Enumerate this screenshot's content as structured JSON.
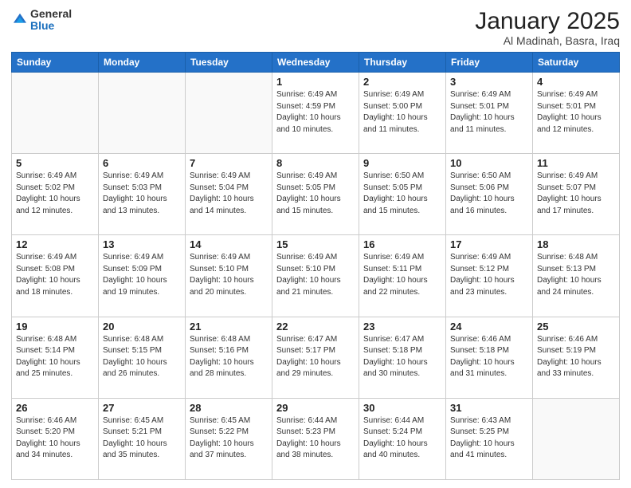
{
  "logo": {
    "general": "General",
    "blue": "Blue"
  },
  "title": {
    "month": "January 2025",
    "location": "Al Madinah, Basra, Iraq"
  },
  "weekdays": [
    "Sunday",
    "Monday",
    "Tuesday",
    "Wednesday",
    "Thursday",
    "Friday",
    "Saturday"
  ],
  "weeks": [
    [
      {
        "day": "",
        "info": ""
      },
      {
        "day": "",
        "info": ""
      },
      {
        "day": "",
        "info": ""
      },
      {
        "day": "1",
        "info": "Sunrise: 6:49 AM\nSunset: 4:59 PM\nDaylight: 10 hours\nand 10 minutes."
      },
      {
        "day": "2",
        "info": "Sunrise: 6:49 AM\nSunset: 5:00 PM\nDaylight: 10 hours\nand 11 minutes."
      },
      {
        "day": "3",
        "info": "Sunrise: 6:49 AM\nSunset: 5:01 PM\nDaylight: 10 hours\nand 11 minutes."
      },
      {
        "day": "4",
        "info": "Sunrise: 6:49 AM\nSunset: 5:01 PM\nDaylight: 10 hours\nand 12 minutes."
      }
    ],
    [
      {
        "day": "5",
        "info": "Sunrise: 6:49 AM\nSunset: 5:02 PM\nDaylight: 10 hours\nand 12 minutes."
      },
      {
        "day": "6",
        "info": "Sunrise: 6:49 AM\nSunset: 5:03 PM\nDaylight: 10 hours\nand 13 minutes."
      },
      {
        "day": "7",
        "info": "Sunrise: 6:49 AM\nSunset: 5:04 PM\nDaylight: 10 hours\nand 14 minutes."
      },
      {
        "day": "8",
        "info": "Sunrise: 6:49 AM\nSunset: 5:05 PM\nDaylight: 10 hours\nand 15 minutes."
      },
      {
        "day": "9",
        "info": "Sunrise: 6:50 AM\nSunset: 5:05 PM\nDaylight: 10 hours\nand 15 minutes."
      },
      {
        "day": "10",
        "info": "Sunrise: 6:50 AM\nSunset: 5:06 PM\nDaylight: 10 hours\nand 16 minutes."
      },
      {
        "day": "11",
        "info": "Sunrise: 6:49 AM\nSunset: 5:07 PM\nDaylight: 10 hours\nand 17 minutes."
      }
    ],
    [
      {
        "day": "12",
        "info": "Sunrise: 6:49 AM\nSunset: 5:08 PM\nDaylight: 10 hours\nand 18 minutes."
      },
      {
        "day": "13",
        "info": "Sunrise: 6:49 AM\nSunset: 5:09 PM\nDaylight: 10 hours\nand 19 minutes."
      },
      {
        "day": "14",
        "info": "Sunrise: 6:49 AM\nSunset: 5:10 PM\nDaylight: 10 hours\nand 20 minutes."
      },
      {
        "day": "15",
        "info": "Sunrise: 6:49 AM\nSunset: 5:10 PM\nDaylight: 10 hours\nand 21 minutes."
      },
      {
        "day": "16",
        "info": "Sunrise: 6:49 AM\nSunset: 5:11 PM\nDaylight: 10 hours\nand 22 minutes."
      },
      {
        "day": "17",
        "info": "Sunrise: 6:49 AM\nSunset: 5:12 PM\nDaylight: 10 hours\nand 23 minutes."
      },
      {
        "day": "18",
        "info": "Sunrise: 6:48 AM\nSunset: 5:13 PM\nDaylight: 10 hours\nand 24 minutes."
      }
    ],
    [
      {
        "day": "19",
        "info": "Sunrise: 6:48 AM\nSunset: 5:14 PM\nDaylight: 10 hours\nand 25 minutes."
      },
      {
        "day": "20",
        "info": "Sunrise: 6:48 AM\nSunset: 5:15 PM\nDaylight: 10 hours\nand 26 minutes."
      },
      {
        "day": "21",
        "info": "Sunrise: 6:48 AM\nSunset: 5:16 PM\nDaylight: 10 hours\nand 28 minutes."
      },
      {
        "day": "22",
        "info": "Sunrise: 6:47 AM\nSunset: 5:17 PM\nDaylight: 10 hours\nand 29 minutes."
      },
      {
        "day": "23",
        "info": "Sunrise: 6:47 AM\nSunset: 5:18 PM\nDaylight: 10 hours\nand 30 minutes."
      },
      {
        "day": "24",
        "info": "Sunrise: 6:46 AM\nSunset: 5:18 PM\nDaylight: 10 hours\nand 31 minutes."
      },
      {
        "day": "25",
        "info": "Sunrise: 6:46 AM\nSunset: 5:19 PM\nDaylight: 10 hours\nand 33 minutes."
      }
    ],
    [
      {
        "day": "26",
        "info": "Sunrise: 6:46 AM\nSunset: 5:20 PM\nDaylight: 10 hours\nand 34 minutes."
      },
      {
        "day": "27",
        "info": "Sunrise: 6:45 AM\nSunset: 5:21 PM\nDaylight: 10 hours\nand 35 minutes."
      },
      {
        "day": "28",
        "info": "Sunrise: 6:45 AM\nSunset: 5:22 PM\nDaylight: 10 hours\nand 37 minutes."
      },
      {
        "day": "29",
        "info": "Sunrise: 6:44 AM\nSunset: 5:23 PM\nDaylight: 10 hours\nand 38 minutes."
      },
      {
        "day": "30",
        "info": "Sunrise: 6:44 AM\nSunset: 5:24 PM\nDaylight: 10 hours\nand 40 minutes."
      },
      {
        "day": "31",
        "info": "Sunrise: 6:43 AM\nSunset: 5:25 PM\nDaylight: 10 hours\nand 41 minutes."
      },
      {
        "day": "",
        "info": ""
      }
    ]
  ]
}
